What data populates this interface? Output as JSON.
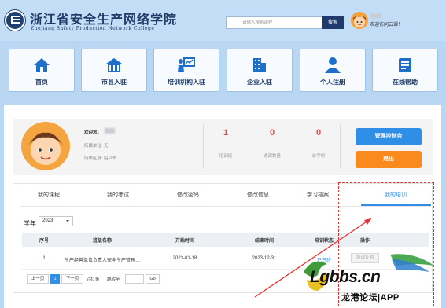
{
  "header": {
    "site_title_cn": "浙江省安全生产网络学院",
    "site_title_en": "Zhejiang Safety Production Network College",
    "search_placeholder": "请输入搜索课程",
    "search_button": "搜索",
    "welcome_text": "欢迎访问云课！"
  },
  "nav": [
    {
      "label": "首页",
      "icon": "home-icon"
    },
    {
      "label": "市县入驻",
      "icon": "city-icon"
    },
    {
      "label": "培训机构入驻",
      "icon": "trainer-icon"
    },
    {
      "label": "企业入驻",
      "icon": "building-icon"
    },
    {
      "label": "个人注册",
      "icon": "person-icon"
    },
    {
      "label": "在线帮助",
      "icon": "help-icon"
    }
  ],
  "profile": {
    "greeting": "欢迎您，",
    "org_label": "所属单位: 无",
    "region_label": "所属区县: 绍兴市",
    "stats": [
      {
        "value": "1",
        "label": "培训班"
      },
      {
        "value": "0",
        "label": "选课数量"
      },
      {
        "value": "0",
        "label": "总学时"
      }
    ],
    "console_button": "管理控制台",
    "logout_button": "退出"
  },
  "tabs": [
    "我的课程",
    "我的考试",
    "修改密码",
    "修改信息",
    "学习档案",
    "我的培训"
  ],
  "active_tab_index": 5,
  "filter": {
    "year_label": "学年",
    "year_value": "2023"
  },
  "table": {
    "headers": [
      "序号",
      "班级名称",
      "开始时间",
      "结束时间",
      "培训状态",
      "操作"
    ],
    "rows": [
      {
        "index": "1",
        "name": "生产经营单位负责人安全生产管理…",
        "start": "2023-01-18",
        "end": "2023-12-31",
        "status": "已开班",
        "action": "培训证明"
      }
    ]
  },
  "pagination": {
    "prev": "上一页",
    "current": "1",
    "next": "下一页",
    "total": "/共1条",
    "jump_label": "跳转至",
    "go": "Go"
  },
  "watermark": {
    "site": "Lgbbs.cn",
    "sub": "龙港论坛|APP"
  },
  "colors": {
    "brand_navy": "#1f3b66",
    "accent_blue": "#2f8fe7",
    "logout_orange": "#fa8a1d",
    "stat_red": "#e84b4b",
    "annotation_red": "#e53030"
  }
}
